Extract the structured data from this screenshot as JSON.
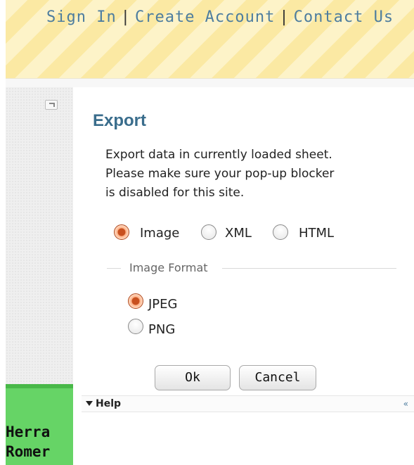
{
  "header": {
    "links": [
      "Sign In",
      "Create Account",
      "Contact Us"
    ],
    "separator": "|"
  },
  "dialog": {
    "title": "Export",
    "description": [
      "Export data in currently loaded sheet.",
      "Please make sure your pop-up blocker",
      "is disabled for this site."
    ],
    "export_types": [
      {
        "label": "Image",
        "checked": true
      },
      {
        "label": "XML",
        "checked": false
      },
      {
        "label": "HTML",
        "checked": false
      }
    ],
    "image_format": {
      "legend": "Image Format",
      "options": [
        {
          "label": "JPEG",
          "checked": true
        },
        {
          "label": "PNG",
          "checked": false
        }
      ]
    },
    "ok_label": "Ok",
    "cancel_label": "Cancel"
  },
  "help": {
    "label": "Help",
    "collapse_icon": "double-left-arrow-icon",
    "collapse_glyph": "«"
  },
  "left_panel": {
    "text": [
      "Herra",
      "Romer"
    ]
  },
  "colors": {
    "link": "#4d7d9f",
    "title": "#3a6d8c",
    "green": "#66d466",
    "radio_checked": "#c8501f"
  }
}
